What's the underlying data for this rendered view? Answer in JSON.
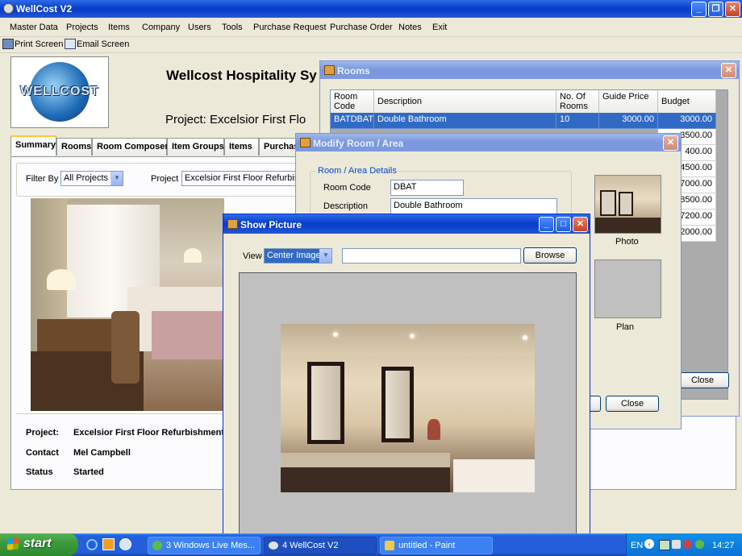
{
  "main_window": {
    "title": "WellCost V2",
    "menu": [
      "Master Data",
      "Projects",
      "Items",
      "Company",
      "Users",
      "Tools",
      "Purchase Request",
      "Purchase Order",
      "Notes",
      "Exit"
    ],
    "toolbar": {
      "print": "Print Screen",
      "email": "Email Screen"
    },
    "logo_text": "WELLCOST",
    "heading": "Wellcost Hospitality Sy",
    "project_heading": "Project:  Excelsior First Flo",
    "tabs": [
      "Summary",
      "Rooms",
      "Room Composer",
      "Item Groups",
      "Items",
      "Purchas"
    ],
    "filter": {
      "label": "Filter By",
      "value": "All Projects",
      "project_label": "Project",
      "project_value": "Excelsior First Floor Refurbishme"
    },
    "info": {
      "project_label": "Project:",
      "project_value": "Excelsior First Floor Refurbishment",
      "contact_label": "Contact",
      "contact_value": "Mel Campbell",
      "status_label": "Status",
      "status_value": "Started"
    }
  },
  "rooms_window": {
    "title": "Rooms",
    "columns": [
      "Room Code",
      "Description",
      "No. Of Rooms",
      "Guide Price",
      "Budget"
    ],
    "first_row": {
      "code": "BATDBAT",
      "desc": "Double Bathroom",
      "count": "10",
      "price": "3000.00",
      "budget": "3000.00"
    },
    "budgets": [
      "3500.00",
      "400.00",
      "4500.00",
      "7000.00",
      "8500.00",
      "7200.00",
      "2000.00"
    ],
    "close": "Close"
  },
  "modify_window": {
    "title": "Modify Room / Area",
    "group": "Room / Area Details",
    "code_label": "Room Code",
    "code_value": "DBAT",
    "desc_label": "Description",
    "desc_value": "Double Bathroom",
    "photo_label": "Photo",
    "plan_label": "Plan",
    "close": "Close"
  },
  "picture_window": {
    "title": "Show Picture",
    "view_label": "View",
    "view_value": "Center Image",
    "browse": "Browse"
  },
  "taskbar": {
    "start": "start",
    "tasks": [
      "3 Windows Live Mes...",
      "4 WellCost V2",
      "untitled - Paint"
    ],
    "lang": "EN",
    "clock": "14:27"
  },
  "colors": {
    "xp_blue": "#0A3FC9",
    "selected_row": "#316AC5",
    "taskbar": "#245EDB",
    "start": "#3C9A3C"
  }
}
